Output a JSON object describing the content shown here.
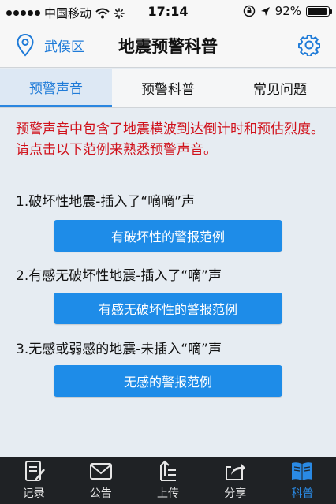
{
  "status": {
    "carrier": "中国移动",
    "time": "17:14",
    "battery": "92%",
    "battery_level": 0.92
  },
  "header": {
    "location": "武侯区",
    "title": "地震预警科普",
    "icons": {
      "location": "location-pin-icon",
      "settings": "gear-icon"
    }
  },
  "tabs": [
    {
      "label": "预警声音",
      "active": true
    },
    {
      "label": "预警科普",
      "active": false
    },
    {
      "label": "常见问题",
      "active": false
    }
  ],
  "intro_text": "预警声音中包含了地震横波到达倒计时和预估烈度。请点击以下范例来熟悉预警声音。",
  "examples": [
    {
      "label": "1.破坏性地震-插入了“嘀嘀”声",
      "button": "有破坏性的警报范例"
    },
    {
      "label": "2.有感无破坏性地震-插入了“嘀”声",
      "button": "有感无破坏性的警报范例"
    },
    {
      "label": "3.无感或弱感的地震-未插入“嘀”声",
      "button": "无感的警报范例"
    }
  ],
  "bottom_nav": [
    {
      "label": "记录",
      "icon": "record-icon",
      "active": false
    },
    {
      "label": "公告",
      "icon": "announcement-icon",
      "active": false
    },
    {
      "label": "上传",
      "icon": "upload-icon",
      "active": false
    },
    {
      "label": "分享",
      "icon": "share-icon",
      "active": false
    },
    {
      "label": "科普",
      "icon": "book-icon",
      "active": true
    }
  ],
  "colors": {
    "accent": "#1f7bd8",
    "warning_text": "#d0111b",
    "button": "#1e8ce8",
    "tabbar_bg": "#1f2225"
  }
}
